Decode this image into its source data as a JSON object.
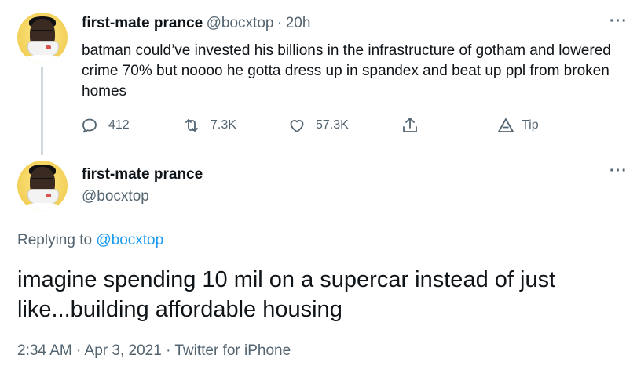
{
  "parent_tweet": {
    "author_name": "first-mate prance",
    "author_handle": "@bocxtop",
    "separator": "·",
    "time": "20h",
    "text": "batman could’ve invested his billions in the infrastructure of gotham and lowered crime 70% but noooo he gotta dress up in spandex and beat up ppl from broken homes",
    "more_label": "···",
    "actions": {
      "reply_count": "412",
      "retweet_count": "7.3K",
      "like_count": "57.3K",
      "tip_label": "Tip"
    }
  },
  "reply_tweet": {
    "author_name": "first-mate prance",
    "author_handle": "@bocxtop",
    "more_label": "···",
    "replying_prefix": "Replying to",
    "replying_to": "@bocxtop",
    "text": "imagine spending 10 mil on a supercar instead of just like...building affordable housing",
    "footer": "2:34 AM · Apr 3, 2021 · Twitter for iPhone"
  },
  "icons": {
    "reply": "reply-icon",
    "retweet": "retweet-icon",
    "like": "heart-icon",
    "share": "share-icon",
    "tip": "tip-icon"
  },
  "colors": {
    "text": "#0f1419",
    "secondary": "#536471",
    "link": "#1d9bf0",
    "thread_line": "#cfd9de"
  }
}
